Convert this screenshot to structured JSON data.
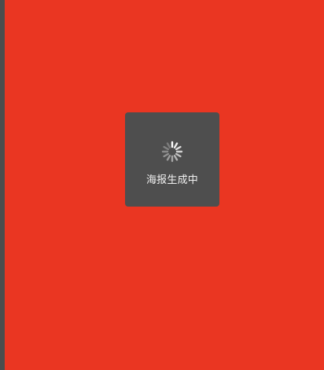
{
  "toast": {
    "message": "海报生成中",
    "icon": "loading-spinner-icon"
  },
  "colors": {
    "page_background": "#ea3622",
    "toast_background": "#4e4e4e",
    "toast_text": "#f2f2f2",
    "left_border": "#4d4d4d"
  }
}
